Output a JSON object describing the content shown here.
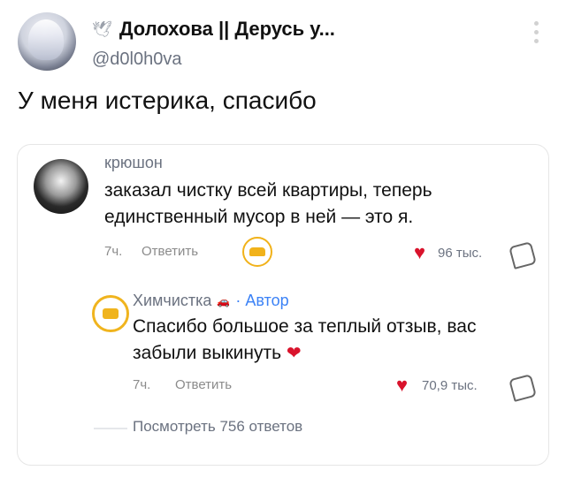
{
  "post": {
    "author_name": "Долохова || Дерусь у...",
    "handle": "@d0l0h0va",
    "text": "У меня истерика, спасибо"
  },
  "screenshot": {
    "comment": {
      "username": "крюшон",
      "text": "заказал чистку всей квартиры, теперь единственный мусор в ней — это я.",
      "time": "7ч.",
      "reply_label": "Ответить",
      "likes": "96 тыс."
    },
    "reply": {
      "username": "Химчистка",
      "author_badge": "· Автор",
      "text": "Спасибо большое за теплый отзыв, вас забыли выкинуть",
      "time": "7ч.",
      "reply_label": "Ответить",
      "likes": "70,9 тыс."
    },
    "view_more": "Посмотреть 756 ответов"
  },
  "colors": {
    "heart": "#d9132c",
    "author_blue": "#3b82f6",
    "sticker_yellow": "#f1b21a"
  }
}
